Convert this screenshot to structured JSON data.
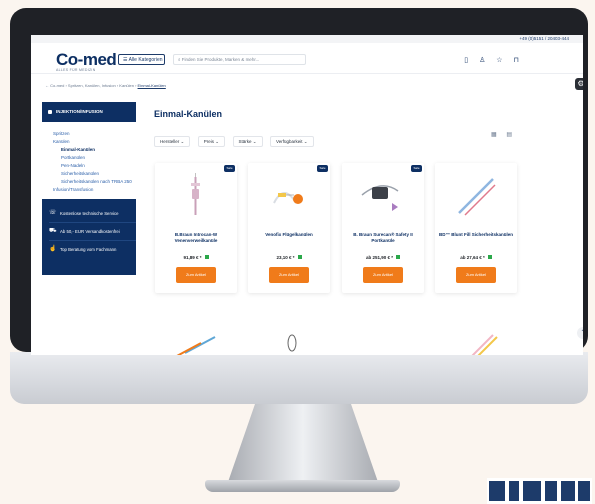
{
  "topbar": {
    "phone": "+49 (0)5151 / 20403-444"
  },
  "header": {
    "logo": "Co-med",
    "logo_tagline": "ALLES FÜR MEDIZIN",
    "all_categories": "Alle Kategorien",
    "search_placeholder": "Finden Sie Produkte, Marken & mehr..."
  },
  "breadcrumb": {
    "items": [
      "Co-med",
      "Spritzen, Kanülen, Infusion",
      "Kanülen"
    ],
    "current": "Einmal-Kanülen"
  },
  "sidebar": {
    "heading": "INJEKTION/INFUSION",
    "items": [
      {
        "label": "Spritzen"
      },
      {
        "label": "Kanülen"
      },
      {
        "label": "Einmal-Kanülen"
      },
      {
        "label": "Portkanülen"
      },
      {
        "label": "Pen-Nadeln"
      },
      {
        "label": "Sicherheitskanülen"
      },
      {
        "label": "Sicherheitskanülen nach TRBA 250"
      },
      {
        "label": "Infusion/Transfusion"
      }
    ],
    "services": [
      {
        "icon": "phone-icon",
        "label": "Kostenlose technische Service"
      },
      {
        "icon": "truck-icon",
        "label": "Ab 50,- EUR Versandkostenfrei"
      },
      {
        "icon": "thumbs-up-icon",
        "label": "Top Beratung vom Fachmann"
      }
    ]
  },
  "main": {
    "title": "Einmal-Kanülen",
    "filters": [
      "Hersteller",
      "Preis",
      "Stärke",
      "Verfügbarkeit"
    ]
  },
  "products": [
    {
      "name": "B.Braun Introcan-W Venenverweilkanüle",
      "price": "91,89 €",
      "button": "Zum Artikel",
      "badge": "Sale"
    },
    {
      "name": "Venofix Flügelkanülen",
      "price": "23,10 €",
      "button": "Zum Artikel",
      "badge": "Sale"
    },
    {
      "name": "B. Braun Surecan® Safety II Portkanüle",
      "price": "ab 251,90 €",
      "button": "Zum Artikel",
      "badge": "Sale"
    },
    {
      "name": "BD™ Blunt Fill Sicherheitskanülen",
      "price": "ab 27,64 €",
      "button": "Zum Artikel",
      "badge": ""
    }
  ],
  "colors": {
    "navy": "#0d2f63",
    "orange": "#f07b1a",
    "green": "#2ba84a"
  }
}
